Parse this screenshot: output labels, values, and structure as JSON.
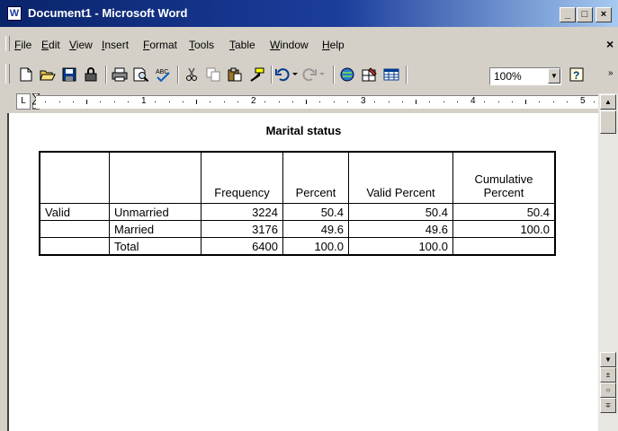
{
  "window": {
    "title": "Document1 - Microsoft Word",
    "app_icon": "W",
    "caption_buttons": {
      "minimize": "_",
      "maximize": "□",
      "close": "×"
    }
  },
  "menu": {
    "items": [
      "File",
      "Edit",
      "View",
      "Insert",
      "Format",
      "Tools",
      "Table",
      "Window",
      "Help"
    ],
    "doc_close": "×"
  },
  "toolbar": {
    "icons": [
      "new-document-icon",
      "open-folder-icon",
      "save-icon",
      "permission-icon",
      "print-icon",
      "print-preview-icon",
      "spelling-icon",
      "cut-icon",
      "copy-icon",
      "paste-icon",
      "format-painter-icon",
      "undo-icon",
      "redo-icon",
      "hyperlink-icon",
      "tables-borders-icon",
      "insert-table-icon",
      "help-icon"
    ],
    "zoom": "100%"
  },
  "ruler": {
    "numbers": [
      "1",
      "2",
      "3",
      "4",
      "5"
    ]
  },
  "document": {
    "table_title": "Marital status",
    "headers": [
      "",
      "",
      "Frequency",
      "Percent",
      "Valid Percent",
      "Cumulative Percent"
    ],
    "rows": [
      [
        "Valid",
        "Unmarried",
        "3224",
        "50.4",
        "50.4",
        "50.4"
      ],
      [
        "",
        "Married",
        "3176",
        "49.6",
        "49.6",
        "100.0"
      ],
      [
        "",
        "Total",
        "6400",
        "100.0",
        "100.0",
        ""
      ]
    ]
  },
  "colors": {
    "titlebar_start": "#0a246a",
    "titlebar_end": "#a6caf0",
    "chrome": "#d4d0c8"
  }
}
